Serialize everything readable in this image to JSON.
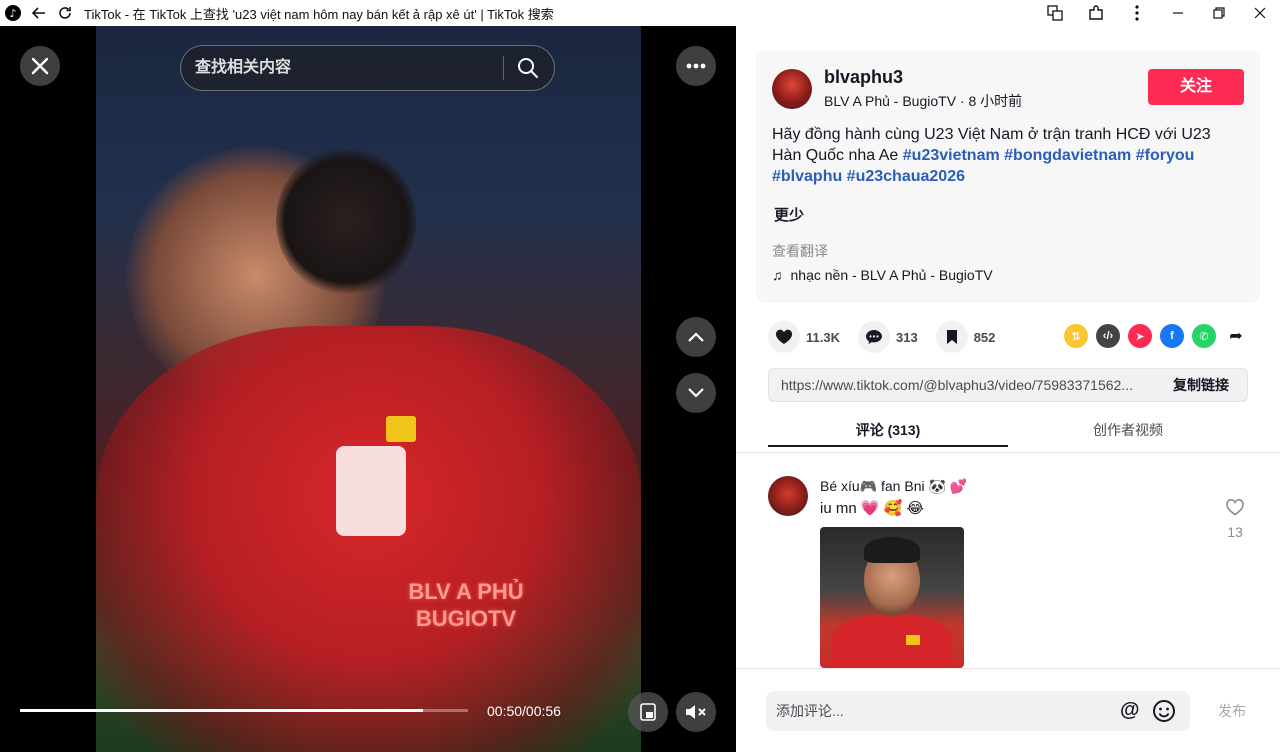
{
  "window": {
    "title": "TikTok - 在 TikTok 上查找 'u23 việt nam hôm nay bán kết ả rập xê út' | TikTok 搜索"
  },
  "player": {
    "search_placeholder": "查找相关内容",
    "time": "00:50/00:56",
    "progress_fraction": 0.9,
    "overlay_caption_line1": "BLV A PHỦ",
    "overlay_caption_line2": "BUGIOTV"
  },
  "post": {
    "author": "blvaphu3",
    "author_sub": "BLV A Phủ - BugioTV · 8 小时前",
    "follow_label": "关注",
    "description": "Hãy đồng hành cùng U23 Việt Nam ở trận tranh HCĐ với U23 Hàn Quốc nha Ae ",
    "hashtags": "#u23vietnam #bongdavietnam #foryou #blvaphu #u23chaua2026",
    "less_label": "更少",
    "translate_label": "查看翻译",
    "music": "nhạc nền - BLV A Phủ - BugioTV"
  },
  "actions": {
    "likes": "11.3K",
    "comments": "313",
    "saves": "852"
  },
  "share": {
    "url": "https://www.tiktok.com/@blvaphu3/video/75983371562...",
    "copy_label": "复制链接"
  },
  "tabs": {
    "comments": "评论 (313)",
    "creator_videos": "创作者视频"
  },
  "comment": {
    "user": "Bé xíu🎮 fan Bni 🐼 💕",
    "text": "iu mn 💗 🥰 😂",
    "likes": "13"
  },
  "footer": {
    "input_placeholder": "添加评论...",
    "at_label": "@",
    "post_label": "发布"
  },
  "colors": {
    "accent": "#fe2c55",
    "hashtag": "#2b5db9"
  }
}
